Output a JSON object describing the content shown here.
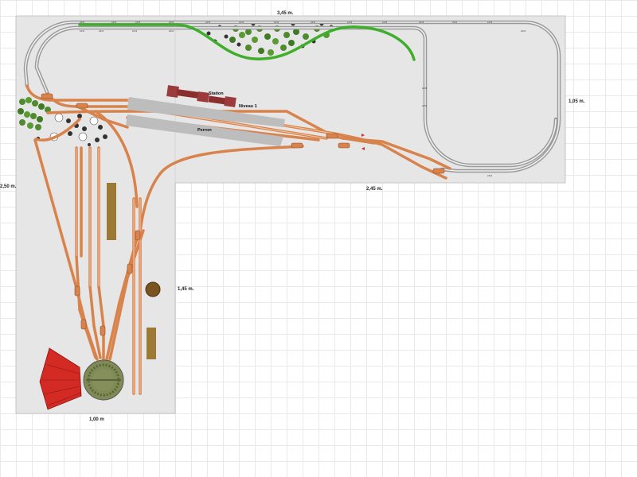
{
  "dimensions": {
    "top_width": "3,45 m.",
    "right_height": "1,05 m.",
    "inner_width": "2,45 m.",
    "left_height": "2,50 m.",
    "inner_height": "1,45 m.",
    "bottom_width": "1,00 m"
  },
  "labels": {
    "station": "Station",
    "level": "Niveau 1",
    "platform": "Perron"
  },
  "track_codes": [
    "L033",
    "L033",
    "L033",
    "L033",
    "L033",
    "L033",
    "L033",
    "L033",
    "L033",
    "L033",
    "L031",
    "L031",
    "L031",
    "L031",
    "L033",
    "L031",
    "L033",
    "L031",
    "L033",
    "L031",
    "L031"
  ],
  "colors": {
    "board": "#e6e6e6",
    "board_border": "#b9b9b9",
    "rail_gray": "#9a9a9a",
    "rail_orange": "#d9834c",
    "rail_green": "#3fae2a",
    "roundhouse": "#d42a24",
    "turntable": "#7f8a55",
    "building": "#9c3b3b",
    "platform": "#bdbdbd",
    "siding_block": "#9c7a36",
    "tree": "#4f8a2e"
  }
}
